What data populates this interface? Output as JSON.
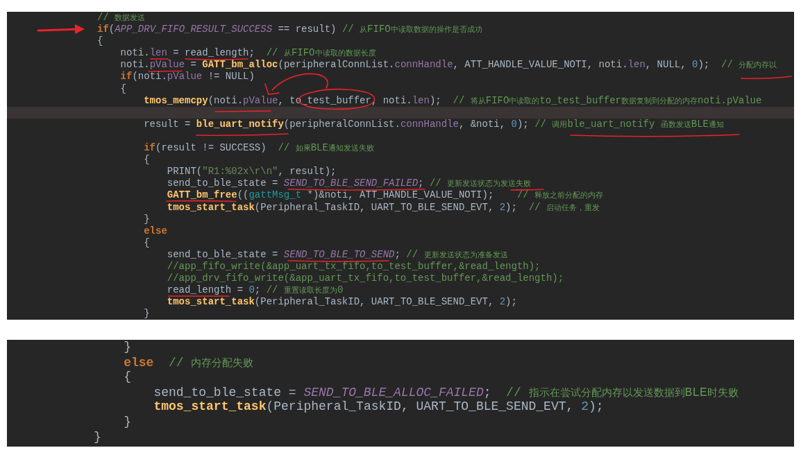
{
  "panels": [
    {
      "lines": [
        {
          "tokens": [
            {
              "kind": "cm",
              "text": "// 数据发送"
            }
          ]
        },
        {
          "tokens": [
            {
              "kind": "kw",
              "text": "if"
            },
            {
              "kind": "plain",
              "text": "("
            },
            {
              "kind": "const",
              "text": "APP_DRV_FIFO_RESULT_SUCCESS"
            },
            {
              "kind": "plain",
              "text": " == result) "
            },
            {
              "kind": "cm",
              "text": "// 从FIFO中读取数据的操作是否成功"
            }
          ]
        },
        {
          "tokens": [
            {
              "kind": "plain",
              "text": "{"
            }
          ]
        },
        {
          "tokens": [
            {
              "kind": "plain",
              "text": "    noti."
            },
            {
              "kind": "field",
              "text": "len"
            },
            {
              "kind": "plain",
              "text": " = read_length;  "
            },
            {
              "kind": "cm",
              "text": "// 从FIFO中读取的数据长度"
            }
          ]
        },
        {
          "tokens": [
            {
              "kind": "plain",
              "text": "    noti."
            },
            {
              "kind": "field",
              "text": "pValue"
            },
            {
              "kind": "plain",
              "text": " = "
            },
            {
              "kind": "fn",
              "text": "GATT_bm_alloc"
            },
            {
              "kind": "plain",
              "text": "(peripheralConnList."
            },
            {
              "kind": "field",
              "text": "connHandle"
            },
            {
              "kind": "plain",
              "text": ", ATT_HANDLE_VALUE_NOTI, noti."
            },
            {
              "kind": "field",
              "text": "len"
            },
            {
              "kind": "plain",
              "text": ", NULL, "
            },
            {
              "kind": "num",
              "text": "0"
            },
            {
              "kind": "plain",
              "text": ");  "
            },
            {
              "kind": "cm",
              "text": "// 分配内存以"
            }
          ]
        },
        {
          "tokens": [
            {
              "kind": "kw",
              "text": "    if"
            },
            {
              "kind": "plain",
              "text": "(noti."
            },
            {
              "kind": "field",
              "text": "pValue"
            },
            {
              "kind": "plain",
              "text": " != NULL)"
            }
          ]
        },
        {
          "tokens": [
            {
              "kind": "plain",
              "text": "    {"
            }
          ]
        },
        {
          "tokens": [
            {
              "kind": "fn",
              "text": "        tmos_memcpy"
            },
            {
              "kind": "plain",
              "text": "(noti."
            },
            {
              "kind": "field",
              "text": "pValue"
            },
            {
              "kind": "plain",
              "text": ", to_test_buffer, noti."
            },
            {
              "kind": "field",
              "text": "len"
            },
            {
              "kind": "plain",
              "text": ");  "
            },
            {
              "kind": "cm",
              "text": "// 将从FIFO中读取的to_test_buffer数据复制到分配的内存noti.pValue"
            }
          ]
        },
        {
          "current": true
        },
        {
          "tokens": [
            {
              "kind": "plain",
              "text": "        result = "
            },
            {
              "kind": "fn",
              "text": "ble_uart_notify"
            },
            {
              "kind": "plain",
              "text": "(peripheralConnList."
            },
            {
              "kind": "field",
              "text": "connHandle"
            },
            {
              "kind": "plain",
              "text": ", &noti, "
            },
            {
              "kind": "num",
              "text": "0"
            },
            {
              "kind": "plain",
              "text": "); "
            },
            {
              "kind": "cm",
              "text": "// 调用ble_uart_notify 函数发送BLE通知"
            }
          ]
        },
        {
          "current": false
        },
        {
          "tokens": [
            {
              "kind": "kw",
              "text": "        if"
            },
            {
              "kind": "plain",
              "text": "(result != SUCCESS)  "
            },
            {
              "kind": "cm",
              "text": "// 如果BLE通知发送失败"
            }
          ]
        },
        {
          "tokens": [
            {
              "kind": "plain",
              "text": "        {"
            }
          ]
        },
        {
          "tokens": [
            {
              "kind": "plain",
              "text": "            PRINT("
            },
            {
              "kind": "str",
              "text": "\"R1:%02x\\r\\n\""
            },
            {
              "kind": "plain",
              "text": ", result);"
            }
          ]
        },
        {
          "tokens": [
            {
              "kind": "plain",
              "text": "            send_to_ble_state = "
            },
            {
              "kind": "const",
              "text": "SEND_TO_BLE_SEND_FAILED"
            },
            {
              "kind": "plain",
              "text": "; "
            },
            {
              "kind": "cm",
              "text": "// 更新发送状态为发送失败"
            }
          ]
        },
        {
          "tokens": [
            {
              "kind": "fn",
              "text": "            GATT_bm_free"
            },
            {
              "kind": "plain",
              "text": "(("
            },
            {
              "kind": "type",
              "text": "gattMsg_t"
            },
            {
              "kind": "plain",
              "text": " *)&noti, ATT_HANDLE_VALUE_NOTI);    "
            },
            {
              "kind": "cm",
              "text": "// 释放之前分配的内存"
            }
          ]
        },
        {
          "tokens": [
            {
              "kind": "fn",
              "text": "            tmos_start_task"
            },
            {
              "kind": "plain",
              "text": "(Peripheral_TaskID, UART_TO_BLE_SEND_EVT, "
            },
            {
              "kind": "num",
              "text": "2"
            },
            {
              "kind": "plain",
              "text": ");  "
            },
            {
              "kind": "cm",
              "text": "// 启动任务，重发"
            }
          ]
        },
        {
          "tokens": [
            {
              "kind": "plain",
              "text": "        }"
            }
          ]
        },
        {
          "tokens": [
            {
              "kind": "kw",
              "text": "        else"
            }
          ]
        },
        {
          "tokens": [
            {
              "kind": "plain",
              "text": "        {"
            }
          ]
        },
        {
          "tokens": [
            {
              "kind": "plain",
              "text": "            send_to_ble_state = "
            },
            {
              "kind": "const",
              "text": "SEND_TO_BLE_TO_SEND"
            },
            {
              "kind": "plain",
              "text": "; "
            },
            {
              "kind": "cm",
              "text": "// 更新发送状态为准备发送"
            }
          ]
        },
        {
          "tokens": [
            {
              "kind": "cm",
              "text": "            //app_fifo_write(&app_uart_tx_fifo,to_test_buffer,&read_length);"
            }
          ]
        },
        {
          "tokens": [
            {
              "kind": "cm",
              "text": "            //app_drv_fifo_write(&app_uart_tx_fifo,to_test_buffer,&read_length);"
            }
          ]
        },
        {
          "tokens": [
            {
              "kind": "plain",
              "text": "            read_length = "
            },
            {
              "kind": "num",
              "text": "0"
            },
            {
              "kind": "plain",
              "text": "; "
            },
            {
              "kind": "cm",
              "text": "// 重置读取长度为0"
            }
          ]
        },
        {
          "tokens": [
            {
              "kind": "fn",
              "text": "            tmos_start_task"
            },
            {
              "kind": "plain",
              "text": "(Peripheral_TaskID, UART_TO_BLE_SEND_EVT, "
            },
            {
              "kind": "num",
              "text": "2"
            },
            {
              "kind": "plain",
              "text": ");"
            }
          ]
        },
        {
          "tokens": [
            {
              "kind": "plain",
              "text": "        }"
            }
          ]
        }
      ]
    },
    {
      "lines": [
        {
          "tokens": [
            {
              "kind": "plain",
              "text": "    }"
            }
          ]
        },
        {
          "tokens": [
            {
              "kind": "kw",
              "text": "    else"
            },
            {
              "kind": "cm",
              "text": "  // 内存分配失败"
            }
          ]
        },
        {
          "tokens": [
            {
              "kind": "plain",
              "text": "    {"
            }
          ]
        },
        {
          "tokens": [
            {
              "kind": "plain",
              "text": "        send_to_ble_state = "
            },
            {
              "kind": "const",
              "text": "SEND_TO_BLE_ALLOC_FAILED"
            },
            {
              "kind": "plain",
              "text": ";  "
            },
            {
              "kind": "cm",
              "text": "// 指示在尝试分配内存以发送数据到BLE时失败"
            }
          ]
        },
        {
          "tokens": [
            {
              "kind": "fn",
              "text": "        tmos_start_task"
            },
            {
              "kind": "plain",
              "text": "(Peripheral_TaskID, UART_TO_BLE_SEND_EVT, "
            },
            {
              "kind": "num",
              "text": "2"
            },
            {
              "kind": "plain",
              "text": ");"
            }
          ]
        },
        {
          "tokens": [
            {
              "kind": "plain",
              "text": "    }"
            }
          ]
        },
        {
          "tokens": [
            {
              "kind": "plain",
              "text": "}"
            }
          ]
        }
      ]
    }
  ]
}
